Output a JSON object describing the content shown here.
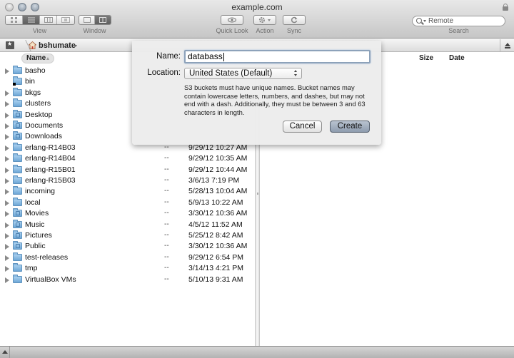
{
  "window": {
    "title": "example.com"
  },
  "toolbar": {
    "view_label": "View",
    "window_label": "Window",
    "quick_look_label": "Quick Look",
    "action_label": "Action",
    "sync_label": "Sync",
    "search_label": "Search",
    "search_value": "Remote",
    "view_modes": [
      "icon-view",
      "list-view",
      "column-view",
      "cover-flow-view"
    ],
    "view_selected": "list-view",
    "window_modes": [
      "single-pane",
      "dual-pane"
    ],
    "window_selected": "dual-pane"
  },
  "path_bar": {
    "crumb": "bshumate"
  },
  "left_pane": {
    "columns": {
      "name": "Name"
    },
    "rows": [
      {
        "name": "basho",
        "size": "",
        "date": "",
        "icon": "folder",
        "expandable": true
      },
      {
        "name": "bin",
        "size": "",
        "date": "",
        "icon": "folder-alias",
        "expandable": false
      },
      {
        "name": "bkgs",
        "size": "",
        "date": "",
        "icon": "folder",
        "expandable": true
      },
      {
        "name": "clusters",
        "size": "",
        "date": "",
        "icon": "folder",
        "expandable": true
      },
      {
        "name": "Desktop",
        "size": "",
        "date": "",
        "icon": "desktop-folder",
        "expandable": true
      },
      {
        "name": "Documents",
        "size": "",
        "date": "",
        "icon": "documents-folder",
        "expandable": true
      },
      {
        "name": "Downloads",
        "size": "",
        "date": "",
        "icon": "downloads-folder",
        "expandable": true
      },
      {
        "name": "erlang-R14B03",
        "size": "--",
        "date": "9/29/12 10:27 AM",
        "icon": "folder",
        "expandable": true
      },
      {
        "name": "erlang-R14B04",
        "size": "--",
        "date": "9/29/12 10:35 AM",
        "icon": "folder",
        "expandable": true
      },
      {
        "name": "erlang-R15B01",
        "size": "--",
        "date": "9/29/12 10:44 AM",
        "icon": "folder",
        "expandable": true
      },
      {
        "name": "erlang-R15B03",
        "size": "--",
        "date": "3/6/13 7:19 PM",
        "icon": "folder",
        "expandable": true
      },
      {
        "name": "incoming",
        "size": "--",
        "date": "5/28/13 10:04 AM",
        "icon": "folder",
        "expandable": true
      },
      {
        "name": "local",
        "size": "--",
        "date": "5/9/13 10:22 AM",
        "icon": "folder",
        "expandable": true
      },
      {
        "name": "Movies",
        "size": "--",
        "date": "3/30/12 10:36 AM",
        "icon": "movies-folder",
        "expandable": true
      },
      {
        "name": "Music",
        "size": "--",
        "date": "4/5/12 11:52 AM",
        "icon": "music-folder",
        "expandable": true
      },
      {
        "name": "Pictures",
        "size": "--",
        "date": "5/25/12 8:42 AM",
        "icon": "pictures-folder",
        "expandable": true
      },
      {
        "name": "Public",
        "size": "--",
        "date": "3/30/12 10:36 AM",
        "icon": "public-folder",
        "expandable": true
      },
      {
        "name": "test-releases",
        "size": "--",
        "date": "9/29/12 6:54 PM",
        "icon": "folder",
        "expandable": true
      },
      {
        "name": "tmp",
        "size": "--",
        "date": "3/14/13 4:21 PM",
        "icon": "folder",
        "expandable": true
      },
      {
        "name": "VirtualBox VMs",
        "size": "--",
        "date": "5/10/13 9:31 AM",
        "icon": "folder",
        "expandable": true
      }
    ]
  },
  "right_pane": {
    "columns": {
      "size": "Size",
      "date": "Date"
    }
  },
  "dialog": {
    "name_label": "Name:",
    "name_value": "databass",
    "location_label": "Location:",
    "location_value": "United States (Default)",
    "help_text": "S3 buckets must have unique names. Bucket names may contain lowercase letters, numbers, and dashes, but may not end with a dash. Additionally, they must be between 3 and 63 characters in length.",
    "cancel_label": "Cancel",
    "create_label": "Create"
  }
}
